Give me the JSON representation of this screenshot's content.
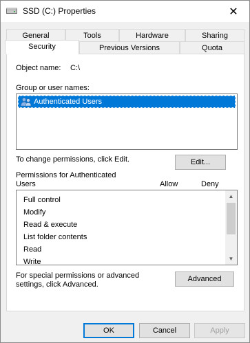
{
  "window": {
    "title": "SSD (C:) Properties",
    "close_glyph": "✕"
  },
  "tabs_row1": [
    "General",
    "Tools",
    "Hardware",
    "Sharing"
  ],
  "tabs_row2": [
    "Security",
    "Previous Versions",
    "Quota"
  ],
  "active_tab": "Security",
  "security": {
    "object_name_label": "Object name:",
    "object_name_value": "C:\\",
    "group_label": "Group or user names:",
    "groups": [
      "Authenticated Users"
    ],
    "selected_group": "Authenticated Users",
    "change_text": "To change permissions, click Edit.",
    "edit_button": "Edit...",
    "permissions_label": "Permissions for Authenticated Users",
    "allow_header": "Allow",
    "deny_header": "Deny",
    "permissions": [
      "Full control",
      "Modify",
      "Read & execute",
      "List folder contents",
      "Read",
      "Write"
    ],
    "advanced_text": "For special permissions or advanced settings, click Advanced.",
    "advanced_button": "Advanced"
  },
  "footer": {
    "ok": "OK",
    "cancel": "Cancel",
    "apply": "Apply"
  },
  "icons": {
    "title_icon": "drive-icon",
    "group_icon": "users-icon"
  },
  "colors": {
    "selection": "#0078d7",
    "window_bg": "#f0f0f0"
  }
}
